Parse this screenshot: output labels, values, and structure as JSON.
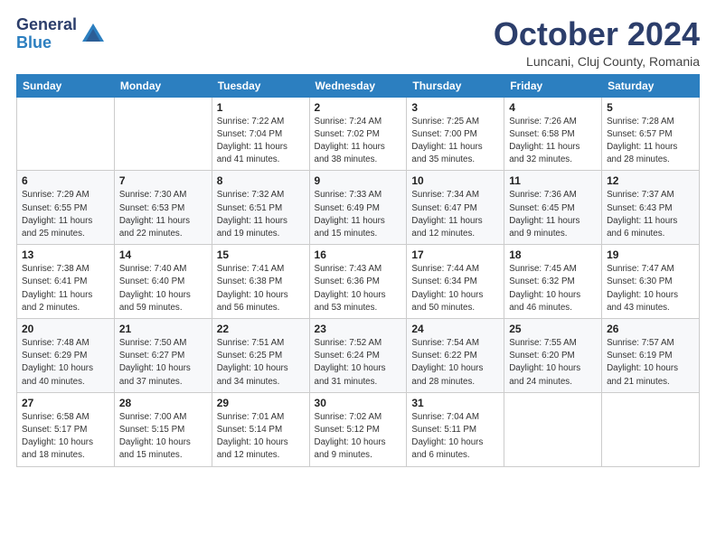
{
  "logo": {
    "general": "General",
    "blue": "Blue"
  },
  "header": {
    "month": "October 2024",
    "location": "Luncani, Cluj County, Romania"
  },
  "days_of_week": [
    "Sunday",
    "Monday",
    "Tuesday",
    "Wednesday",
    "Thursday",
    "Friday",
    "Saturday"
  ],
  "weeks": [
    [
      {
        "day": "",
        "info": ""
      },
      {
        "day": "",
        "info": ""
      },
      {
        "day": "1",
        "info": "Sunrise: 7:22 AM\nSunset: 7:04 PM\nDaylight: 11 hours and 41 minutes."
      },
      {
        "day": "2",
        "info": "Sunrise: 7:24 AM\nSunset: 7:02 PM\nDaylight: 11 hours and 38 minutes."
      },
      {
        "day": "3",
        "info": "Sunrise: 7:25 AM\nSunset: 7:00 PM\nDaylight: 11 hours and 35 minutes."
      },
      {
        "day": "4",
        "info": "Sunrise: 7:26 AM\nSunset: 6:58 PM\nDaylight: 11 hours and 32 minutes."
      },
      {
        "day": "5",
        "info": "Sunrise: 7:28 AM\nSunset: 6:57 PM\nDaylight: 11 hours and 28 minutes."
      }
    ],
    [
      {
        "day": "6",
        "info": "Sunrise: 7:29 AM\nSunset: 6:55 PM\nDaylight: 11 hours and 25 minutes."
      },
      {
        "day": "7",
        "info": "Sunrise: 7:30 AM\nSunset: 6:53 PM\nDaylight: 11 hours and 22 minutes."
      },
      {
        "day": "8",
        "info": "Sunrise: 7:32 AM\nSunset: 6:51 PM\nDaylight: 11 hours and 19 minutes."
      },
      {
        "day": "9",
        "info": "Sunrise: 7:33 AM\nSunset: 6:49 PM\nDaylight: 11 hours and 15 minutes."
      },
      {
        "day": "10",
        "info": "Sunrise: 7:34 AM\nSunset: 6:47 PM\nDaylight: 11 hours and 12 minutes."
      },
      {
        "day": "11",
        "info": "Sunrise: 7:36 AM\nSunset: 6:45 PM\nDaylight: 11 hours and 9 minutes."
      },
      {
        "day": "12",
        "info": "Sunrise: 7:37 AM\nSunset: 6:43 PM\nDaylight: 11 hours and 6 minutes."
      }
    ],
    [
      {
        "day": "13",
        "info": "Sunrise: 7:38 AM\nSunset: 6:41 PM\nDaylight: 11 hours and 2 minutes."
      },
      {
        "day": "14",
        "info": "Sunrise: 7:40 AM\nSunset: 6:40 PM\nDaylight: 10 hours and 59 minutes."
      },
      {
        "day": "15",
        "info": "Sunrise: 7:41 AM\nSunset: 6:38 PM\nDaylight: 10 hours and 56 minutes."
      },
      {
        "day": "16",
        "info": "Sunrise: 7:43 AM\nSunset: 6:36 PM\nDaylight: 10 hours and 53 minutes."
      },
      {
        "day": "17",
        "info": "Sunrise: 7:44 AM\nSunset: 6:34 PM\nDaylight: 10 hours and 50 minutes."
      },
      {
        "day": "18",
        "info": "Sunrise: 7:45 AM\nSunset: 6:32 PM\nDaylight: 10 hours and 46 minutes."
      },
      {
        "day": "19",
        "info": "Sunrise: 7:47 AM\nSunset: 6:30 PM\nDaylight: 10 hours and 43 minutes."
      }
    ],
    [
      {
        "day": "20",
        "info": "Sunrise: 7:48 AM\nSunset: 6:29 PM\nDaylight: 10 hours and 40 minutes."
      },
      {
        "day": "21",
        "info": "Sunrise: 7:50 AM\nSunset: 6:27 PM\nDaylight: 10 hours and 37 minutes."
      },
      {
        "day": "22",
        "info": "Sunrise: 7:51 AM\nSunset: 6:25 PM\nDaylight: 10 hours and 34 minutes."
      },
      {
        "day": "23",
        "info": "Sunrise: 7:52 AM\nSunset: 6:24 PM\nDaylight: 10 hours and 31 minutes."
      },
      {
        "day": "24",
        "info": "Sunrise: 7:54 AM\nSunset: 6:22 PM\nDaylight: 10 hours and 28 minutes."
      },
      {
        "day": "25",
        "info": "Sunrise: 7:55 AM\nSunset: 6:20 PM\nDaylight: 10 hours and 24 minutes."
      },
      {
        "day": "26",
        "info": "Sunrise: 7:57 AM\nSunset: 6:19 PM\nDaylight: 10 hours and 21 minutes."
      }
    ],
    [
      {
        "day": "27",
        "info": "Sunrise: 6:58 AM\nSunset: 5:17 PM\nDaylight: 10 hours and 18 minutes."
      },
      {
        "day": "28",
        "info": "Sunrise: 7:00 AM\nSunset: 5:15 PM\nDaylight: 10 hours and 15 minutes."
      },
      {
        "day": "29",
        "info": "Sunrise: 7:01 AM\nSunset: 5:14 PM\nDaylight: 10 hours and 12 minutes."
      },
      {
        "day": "30",
        "info": "Sunrise: 7:02 AM\nSunset: 5:12 PM\nDaylight: 10 hours and 9 minutes."
      },
      {
        "day": "31",
        "info": "Sunrise: 7:04 AM\nSunset: 5:11 PM\nDaylight: 10 hours and 6 minutes."
      },
      {
        "day": "",
        "info": ""
      },
      {
        "day": "",
        "info": ""
      }
    ]
  ]
}
